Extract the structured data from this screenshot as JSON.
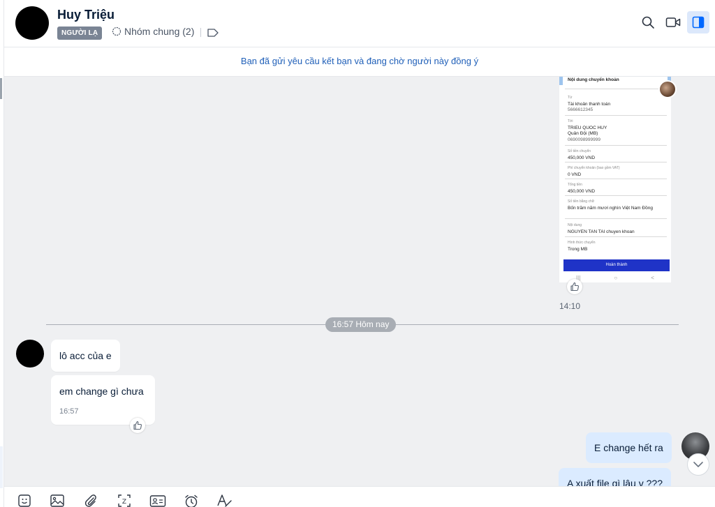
{
  "header": {
    "contact_name": "Huy Triệu",
    "badge": "NGƯỜI LẠ",
    "groups_label": "Nhóm chung (2)",
    "icons": [
      "search-icon",
      "video-call-icon",
      "sidebar-toggle-icon"
    ]
  },
  "notice": "Bạn đã gửi yêu cầu kết bạn và đang chờ người này đồng ý",
  "screenshot": {
    "heading": "Nội dung chuyển khoản",
    "fields": [
      {
        "label": "Từ",
        "value": "Tài khoản thanh toán",
        "sub": "5666612345"
      },
      {
        "label": "Tới",
        "value": "TRIEU QUOC HUY",
        "sub": "Quân Đội (MB)",
        "sub2": "0690098999999"
      },
      {
        "label": "Số tiền chuyển",
        "value": "450,000 VND"
      },
      {
        "label": "Phí chuyển khoản (bao gồm VAT)",
        "value": "0 VND"
      },
      {
        "label": "Tổng tiền",
        "value": "450,000 VND"
      },
      {
        "label": "Số tiền bằng chữ",
        "value": "Bốn trăm năm mươi nghìn Việt Nam Đồng"
      },
      {
        "label": "Nội dung",
        "value": "NGUYEN TAN TAI chuyen khoan"
      },
      {
        "label": "Hình thức chuyển",
        "value": "Trong MB"
      }
    ],
    "button": "Hoàn thành",
    "nav": [
      "|||",
      "○",
      "<"
    ]
  },
  "messages": {
    "image_time": "14:10",
    "divider": "16:57 Hôm nay",
    "incoming": [
      {
        "text": "lô acc của e"
      },
      {
        "text": "em change gì chưa",
        "time": "16:57"
      }
    ],
    "outgoing": [
      {
        "text": "E change hết ra"
      },
      {
        "text": "A xuất file gì lâu v ???"
      }
    ]
  },
  "toolbar": [
    "sticker-icon",
    "image-icon",
    "attachment-icon",
    "screenshot-icon",
    "contact-card-icon",
    "reminder-icon",
    "text-format-icon"
  ],
  "colors": {
    "accent": "#0068ff",
    "outgoing_bubble": "#dbebff",
    "chat_bg": "#eff0f2",
    "button_blue": "#1f33c7"
  }
}
